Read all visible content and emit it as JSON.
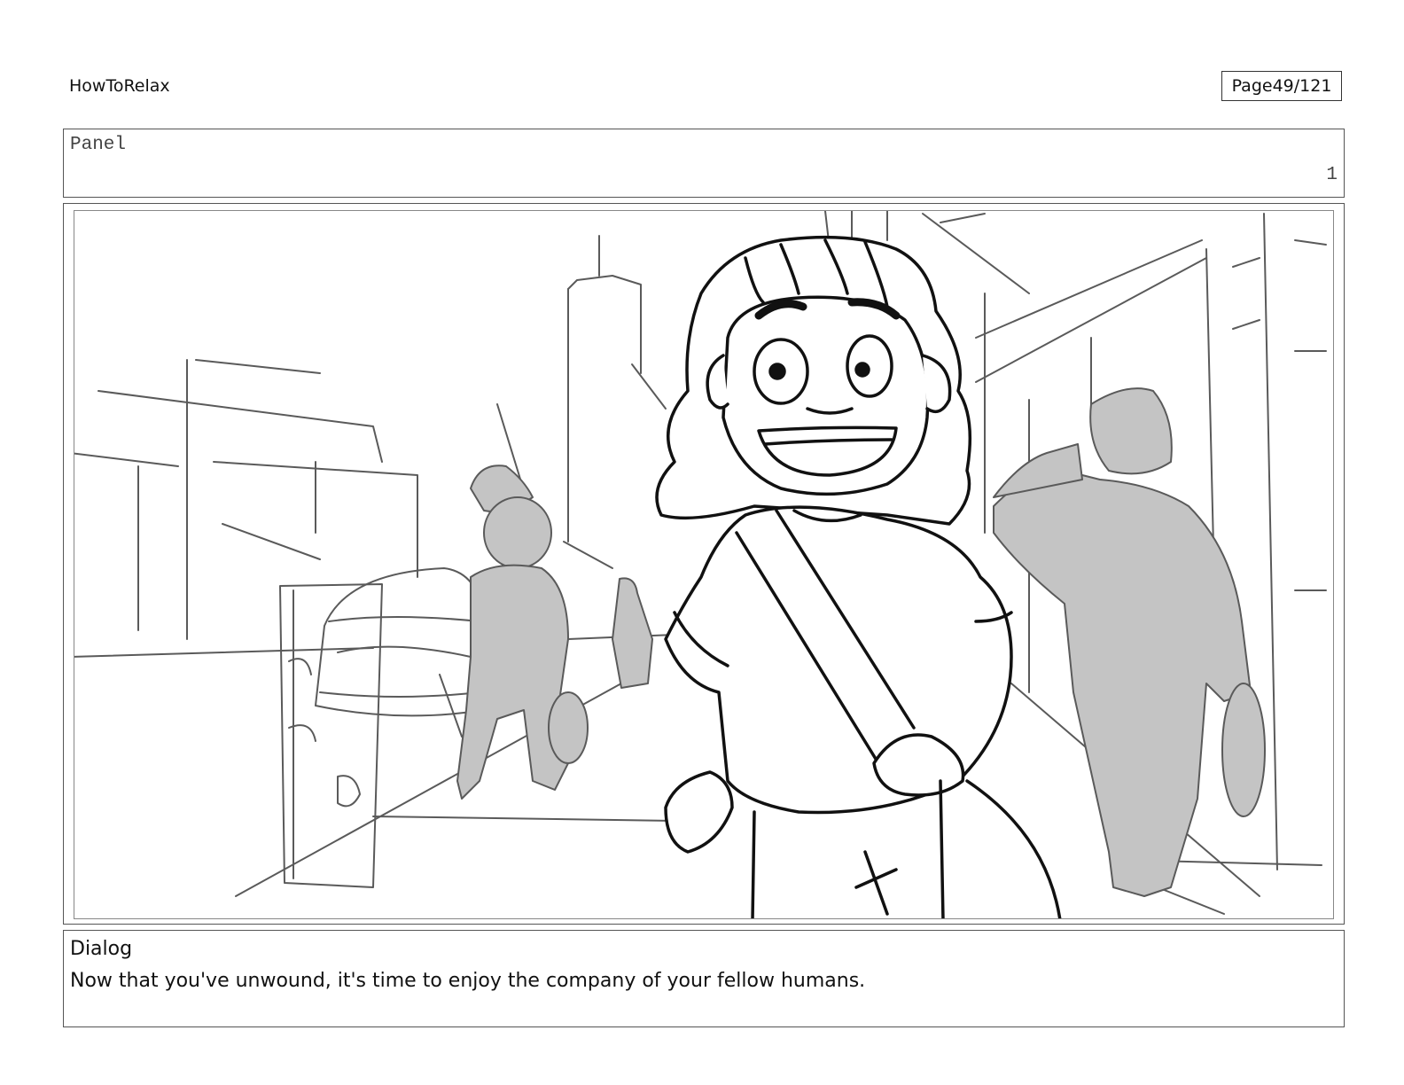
{
  "header": {
    "doc_title": "HowToRelax",
    "page_label": "Page",
    "page_number": "49/121"
  },
  "panel": {
    "label": "Panel",
    "number": "1"
  },
  "dialog": {
    "label": "Dialog",
    "text": "Now that you've unwound, it's time to enjoy the company of your fellow humans."
  },
  "colors": {
    "ink": "#111111",
    "sketch": "#555555",
    "shade": "#c4c4c4",
    "border": "#555555"
  }
}
